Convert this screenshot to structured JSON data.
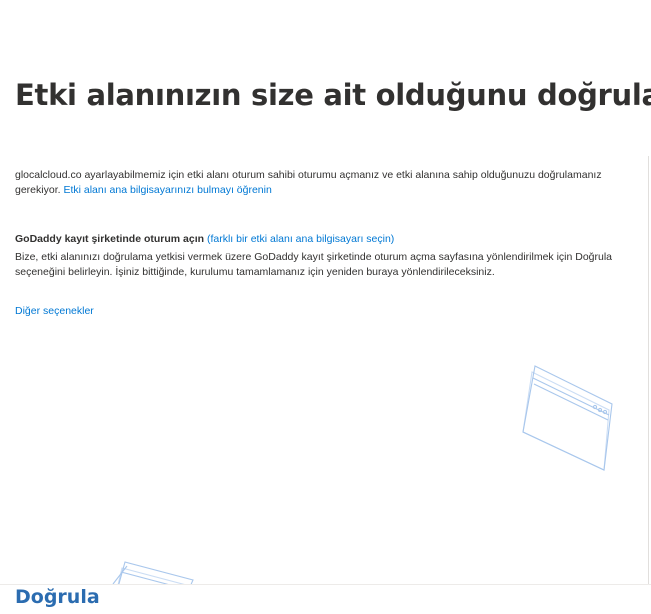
{
  "page": {
    "title": "Etki alanınızın size ait olduğunu doğrulayın"
  },
  "intro": {
    "text": "glocalcloud.co ayarlayabilmemiz için etki alanı oturum sahibi oturumu açmanız ve etki alanına sahip olduğunuzu doğrulamanız gerekiyor. ",
    "link": "Etki alanı ana bilgisayarınızı bulmayı öğrenin"
  },
  "registrar": {
    "heading": "GoDaddy kayıt şirketinde oturum açın",
    "change_link": "(farklı bir etki alanı ana bilgisayarı seçin)",
    "description": "Bize, etki alanınızı doğrulama yetkisi vermek üzere GoDaddy kayıt şirketinde oturum açma sayfasına yönlendirilmek için Doğrula seçeneğini belirleyin. İşiniz bittiğinde, kurulumu tamamlamanız için yeniden buraya yönlendirileceksiniz."
  },
  "options": {
    "other_options_label": "Diğer seçenekler"
  },
  "footer": {
    "verify_label": "Doğrula"
  },
  "icons": {
    "illustration_primary": "browser-window-icon",
    "illustration_secondary": "browser-window-icon"
  },
  "colors": {
    "link": "#0078d4",
    "verify_button": "#2b6cb0",
    "text": "#323130",
    "illustration_stroke": "#a9c7ec"
  }
}
